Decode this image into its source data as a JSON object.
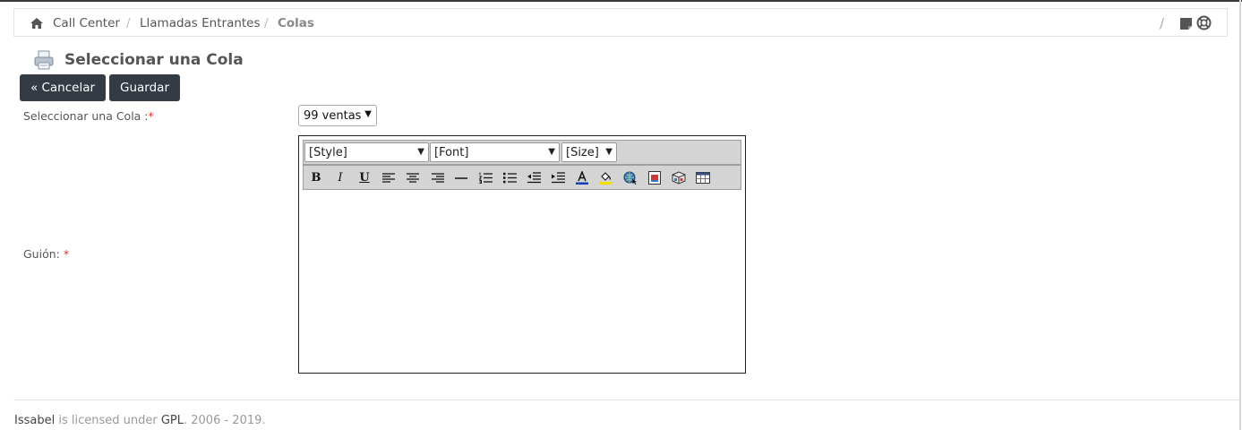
{
  "breadcrumb": {
    "items": [
      "Call Center",
      "Llamadas Entrantes",
      "Colas"
    ],
    "separator": "/"
  },
  "header_right": {
    "separator": "/"
  },
  "page": {
    "title": "Seleccionar una Cola"
  },
  "actions": {
    "cancel_label": "« Cancelar",
    "save_label": "Guardar"
  },
  "form": {
    "queue_label": "Seleccionar una Cola :",
    "queue_required": "*",
    "queue_value": "99 ventas",
    "script_label": "Guión:",
    "script_required": "*"
  },
  "editor": {
    "style_placeholder": "[Style]",
    "font_placeholder": "[Font]",
    "size_placeholder": "[Size]",
    "bold": "B",
    "italic": "I",
    "underline": "U"
  },
  "footer": {
    "brand": "Issabel",
    "text1": " is licensed under ",
    "license": "GPL",
    "text2": ". 2006 - 2019."
  },
  "colors": {
    "button_bg": "#353b45",
    "required": "#d9332c",
    "toolbar_bg": "#d4d4d4"
  }
}
